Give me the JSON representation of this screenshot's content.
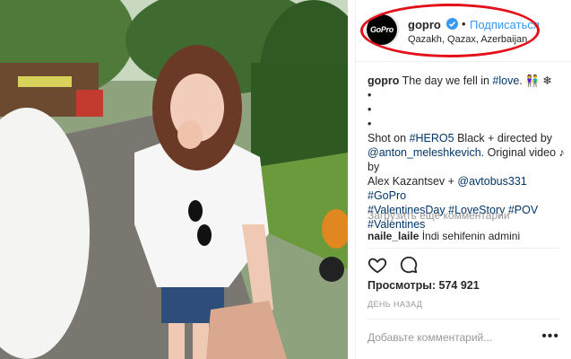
{
  "post": {
    "avatar_text": "GoPro",
    "username": "gopro",
    "dot": "•",
    "follow_label": "Подписаться",
    "location": "Qazakh, Qazax, Azerbaijan"
  },
  "caption": {
    "user": "gopro",
    "text1": " The day we fell in ",
    "tag_love": "#love",
    "text2": ". 👫 ❄",
    "bullets": [
      "•",
      "•",
      "•"
    ],
    "shot_on": "Shot on ",
    "tag_hero": "#HERO5",
    "text3": " Black + directed by ",
    "mention_anton": "@anton_meleshkevich",
    "text4": ". Original video ♪ by",
    "text5": "Alex Kazantsev + ",
    "mention_avtobus": "@avtobus331",
    "text6": " ",
    "tag_gopro": "#GoPro",
    "tag_valentinesday": "#ValentinesDay",
    "tag_lovestory": "#LoveStory",
    "tag_pov": "#POV",
    "tag_valentines": "#Valentines"
  },
  "comments": {
    "load_more": "Загрузить еще комментарии",
    "items": [
      {
        "user": "naile_laile",
        "text": " İndi sehifenin admini"
      }
    ]
  },
  "actions": {
    "heart_icon": "heart-icon",
    "comment_icon": "comment-icon",
    "views_label": "Просмотры: 574 921",
    "time": "ДЕНЬ НАЗАД"
  },
  "add_comment": {
    "placeholder": "Добавьте комментарий...",
    "more": "•••"
  },
  "colors": {
    "accent": "#3897f0",
    "hashtag": "#003569",
    "highlight_oval": "#e3101a"
  }
}
